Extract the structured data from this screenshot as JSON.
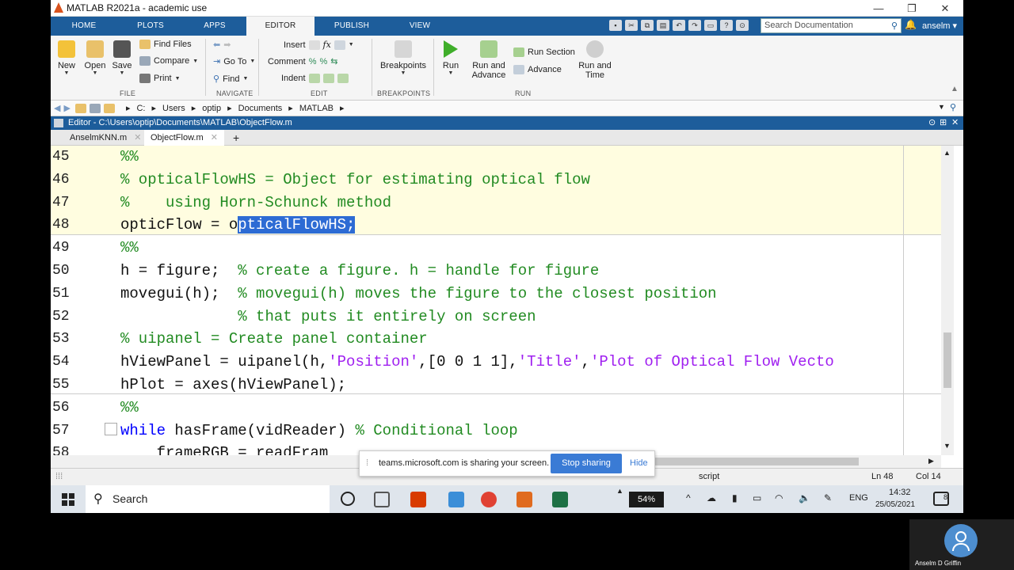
{
  "window": {
    "title": "MATLAB R2021a - academic use",
    "minimize": "—",
    "restore": "❐",
    "close": "✕"
  },
  "tabs": [
    "HOME",
    "PLOTS",
    "APPS",
    "EDITOR",
    "PUBLISH",
    "VIEW"
  ],
  "search": {
    "placeholder": "Search Documentation"
  },
  "user": "anselm",
  "ribbon": {
    "new": "New",
    "open": "Open",
    "save": "Save",
    "find_files": "Find Files",
    "compare": "Compare",
    "print": "Print",
    "go_to": "Go To",
    "find": "Find",
    "insert": "Insert",
    "comment": "Comment",
    "indent": "Indent",
    "breakpoints": "Breakpoints",
    "run": "Run",
    "run_and_advance_1": "Run and",
    "run_and_advance_2": "Advance",
    "run_section": "Run Section",
    "advance": "Advance",
    "run_and_time_1": "Run and",
    "run_and_time_2": "Time",
    "groups": {
      "file": "FILE",
      "navigate": "NAVIGATE",
      "edit": "EDIT",
      "breakpoints": "BREAKPOINTS",
      "run": "RUN"
    }
  },
  "address": [
    "C:",
    "Users",
    "optip",
    "Documents",
    "MATLAB"
  ],
  "editor_header": "Editor - C:\\Users\\optip\\Documents\\MATLAB\\ObjectFlow.m",
  "file_tabs": [
    "AnselmKNN.m",
    "ObjectFlow.m"
  ],
  "code": [
    {
      "n": "45",
      "parts": [
        {
          "t": "%%",
          "c": "cm"
        }
      ]
    },
    {
      "n": "46",
      "parts": [
        {
          "t": "% opticalFlowHS = Object for estimating optical flow",
          "c": "cm"
        }
      ]
    },
    {
      "n": "47",
      "parts": [
        {
          "t": "%    using Horn-Schunck method",
          "c": "cm"
        }
      ]
    },
    {
      "n": "48",
      "parts": [
        {
          "t": "opticFlow = o",
          "c": ""
        },
        {
          "t": "pticalFlowHS;",
          "c": "sel"
        }
      ]
    },
    {
      "n": "49",
      "parts": [
        {
          "t": "%%",
          "c": "cm"
        }
      ]
    },
    {
      "n": "50",
      "parts": [
        {
          "t": "h = figure;  ",
          "c": ""
        },
        {
          "t": "% create a figure. h = handle for figure",
          "c": "cm"
        }
      ]
    },
    {
      "n": "51",
      "parts": [
        {
          "t": "movegui(h);  ",
          "c": ""
        },
        {
          "t": "% movegui(h) moves the figure to the closest position",
          "c": "cm"
        }
      ]
    },
    {
      "n": "52",
      "parts": [
        {
          "t": "             ",
          "c": ""
        },
        {
          "t": "% that puts it entirely on screen",
          "c": "cm"
        }
      ]
    },
    {
      "n": "53",
      "parts": [
        {
          "t": "% uipanel = Create panel container",
          "c": "cm"
        }
      ]
    },
    {
      "n": "54",
      "parts": [
        {
          "t": "hViewPanel = uipanel(h,",
          "c": ""
        },
        {
          "t": "'Position'",
          "c": "st"
        },
        {
          "t": ",[0 0 1 1],",
          "c": ""
        },
        {
          "t": "'Title'",
          "c": "st"
        },
        {
          "t": ",",
          "c": ""
        },
        {
          "t": "'Plot of Optical Flow Vecto",
          "c": "st"
        }
      ]
    },
    {
      "n": "55",
      "parts": [
        {
          "t": "hPlot = axes(hViewPanel);",
          "c": ""
        }
      ]
    },
    {
      "n": "56",
      "parts": [
        {
          "t": "%%",
          "c": "cm"
        }
      ]
    },
    {
      "n": "57",
      "parts": [
        {
          "t": "while",
          "c": "kw"
        },
        {
          "t": " hasFrame(vidReader) ",
          "c": ""
        },
        {
          "t": "% Conditional loop",
          "c": "cm"
        }
      ]
    },
    {
      "n": "58",
      "parts": [
        {
          "t": "    frameRGB = readFram",
          "c": ""
        }
      ]
    }
  ],
  "share_banner": {
    "text": "teams.microsoft.com is sharing your screen.",
    "stop": "Stop sharing",
    "hide": "Hide"
  },
  "status": {
    "mode": "script",
    "ln": "Ln  48",
    "col": "Col  14"
  },
  "taskbar": {
    "search": "Search",
    "battery": "54%",
    "lang": "ENG",
    "time": "14:32",
    "date": "25/05/2021",
    "notif": "8"
  },
  "participant": "Anselm D Griffin",
  "colors": {
    "ribbon_blue": "#1d5d9b",
    "cell_bg": "#fffde0",
    "comment": "#228b22",
    "string": "#a020f0",
    "keyword": "#0000ff",
    "selection": "#2d6bd4"
  }
}
